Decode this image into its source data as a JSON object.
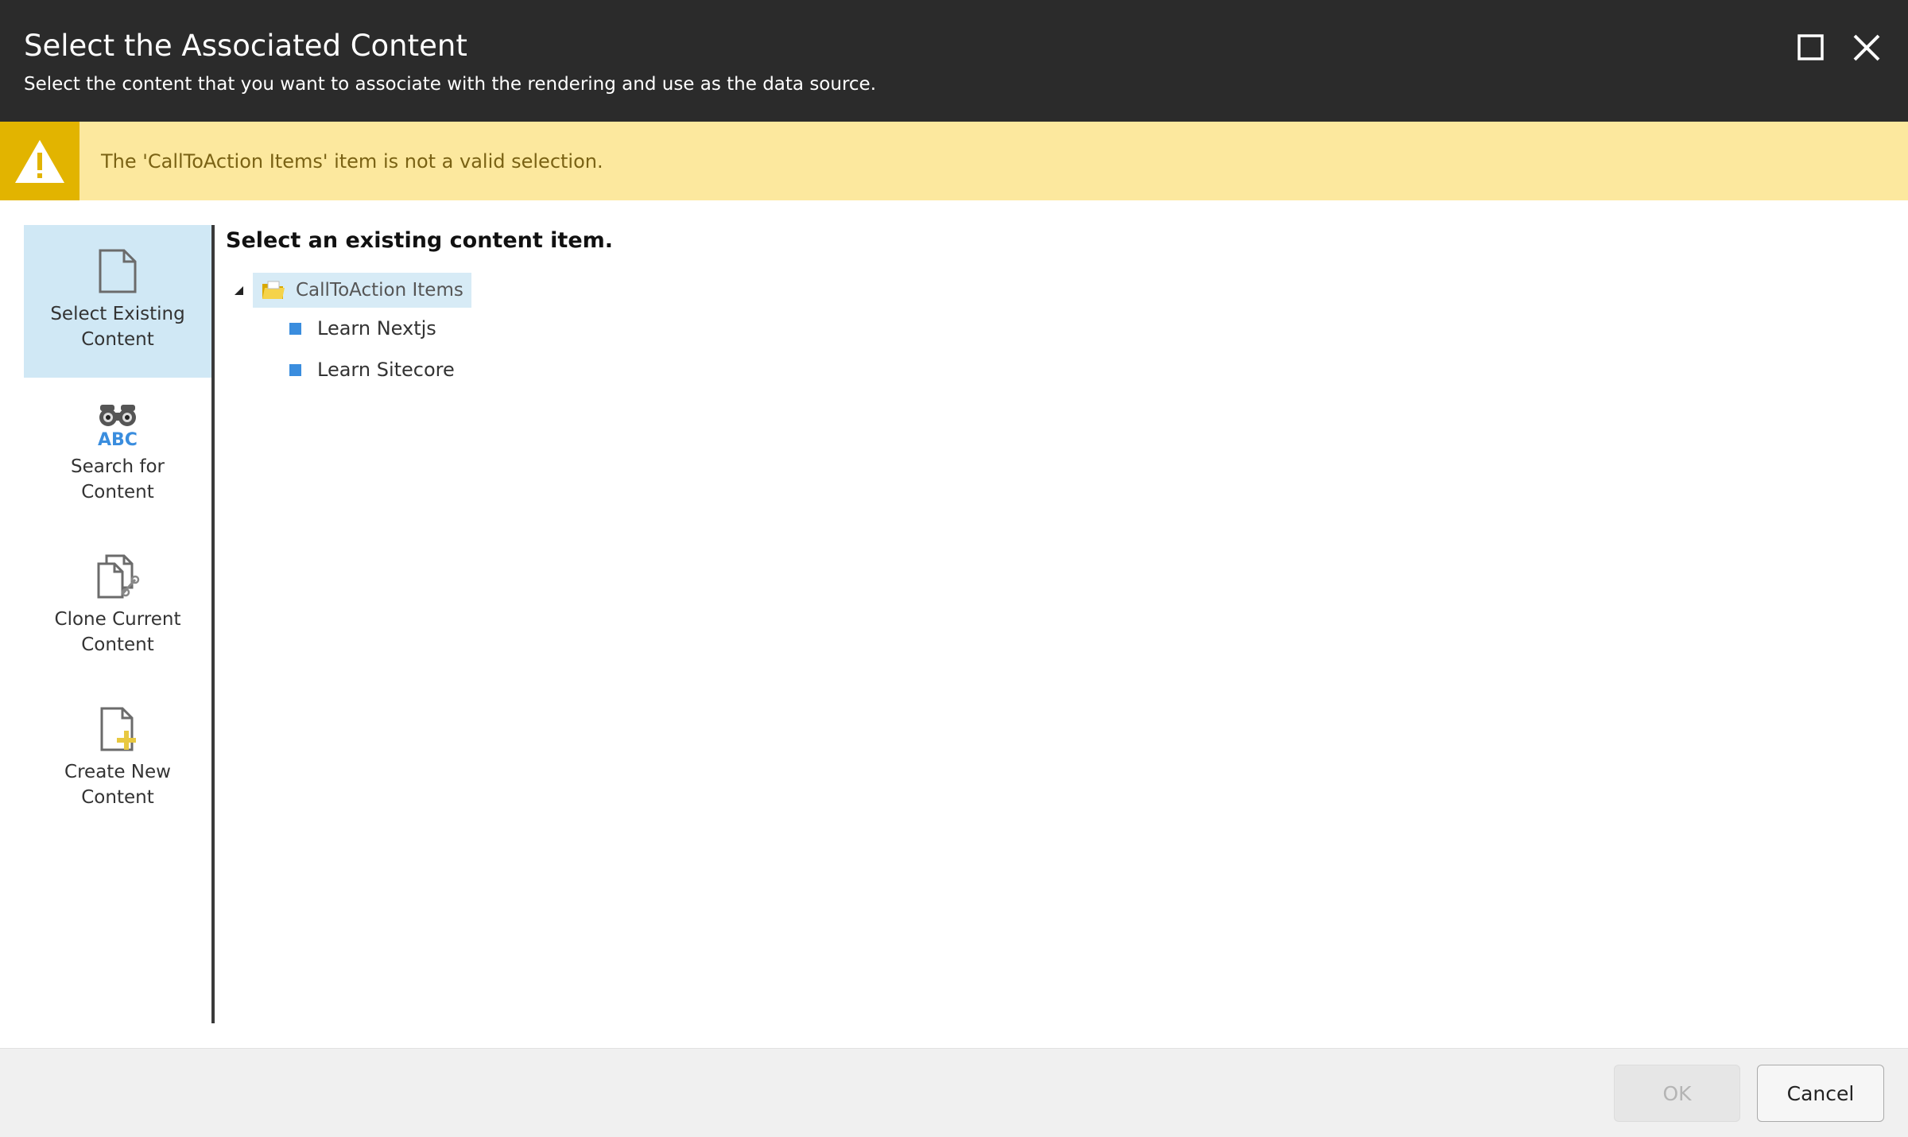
{
  "dialog": {
    "title": "Select the Associated Content",
    "subtitle": "Select the content that you want to associate with the rendering and use as the data source."
  },
  "warning": {
    "message": "The 'CallToAction Items' item is not a valid selection.",
    "icon": "warning-icon",
    "color": "#fce89e",
    "icon_bg": "#e2b400"
  },
  "nav": {
    "items": [
      {
        "line1": "Select Existing",
        "line2": "Content",
        "icon": "document-icon",
        "active": true
      },
      {
        "line1": "Search for",
        "line2": "Content",
        "icon": "binoculars-abc-icon",
        "active": false
      },
      {
        "line1": "Clone Current",
        "line2": "Content",
        "icon": "clone-icon",
        "active": false
      },
      {
        "line1": "Create New",
        "line2": "Content",
        "icon": "new-document-icon",
        "active": false
      }
    ]
  },
  "main": {
    "heading": "Select an existing content item.",
    "tree": {
      "root": {
        "label": "CallToAction Items",
        "icon": "folder-icon",
        "expanded": true,
        "selected": true
      },
      "children": [
        {
          "label": "Learn Nextjs"
        },
        {
          "label": "Learn Sitecore"
        }
      ]
    }
  },
  "footer": {
    "ok_label": "OK",
    "cancel_label": "Cancel"
  },
  "colors": {
    "header_bg": "#2b2b2b",
    "active_nav_bg": "#d0e8f5",
    "bullet": "#3a8dde",
    "footer_bg": "#f0f0f0"
  }
}
